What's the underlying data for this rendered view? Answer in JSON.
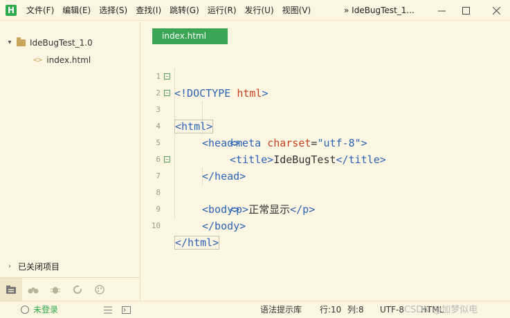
{
  "titlebar": {
    "logo": "H",
    "menu": [
      "文件(F)",
      "编辑(E)",
      "选择(S)",
      "查找(I)",
      "跳转(G)",
      "运行(R)",
      "发行(U)",
      "视图(V)"
    ],
    "window_title": "» IdeBugTest_1..."
  },
  "sidebar": {
    "project": "IdeBugTest_1.0",
    "file": "index.html",
    "closed_projects": "已关闭项目"
  },
  "editor": {
    "tab": "index.html",
    "line_numbers": [
      "1",
      "2",
      "3",
      "4",
      "5",
      "6",
      "7",
      "8",
      "9",
      "10"
    ],
    "lines": {
      "l1": "<!DOCTYPE ",
      "l1b": "html",
      "l1c": ">",
      "l2": "<html>",
      "l3": "<head>",
      "l4a": "<meta ",
      "l4b": "charset",
      "l4c": "=",
      "l4d": "\"utf-8\"",
      "l4e": ">",
      "l5a": "<title>",
      "l5b": "IdeBugTest",
      "l5c": "</title>",
      "l6": "</head>",
      "l7": "<body>",
      "l8a": "<p>",
      "l8b": "正常显示",
      "l8c": "</p>",
      "l9": "</body>",
      "l10": "</html>"
    }
  },
  "statusbar": {
    "login": "未登录",
    "syntax": "语法提示库",
    "row": "行:10",
    "col": "列:8",
    "encoding": "UTF-8",
    "lang": "HTML",
    "watermark": "CSDN @加梦似电"
  },
  "colors": {
    "accent": "#3aa655",
    "tag": "#2a63b4",
    "attribute": "#c2421f",
    "background": "#fdf6e3"
  }
}
